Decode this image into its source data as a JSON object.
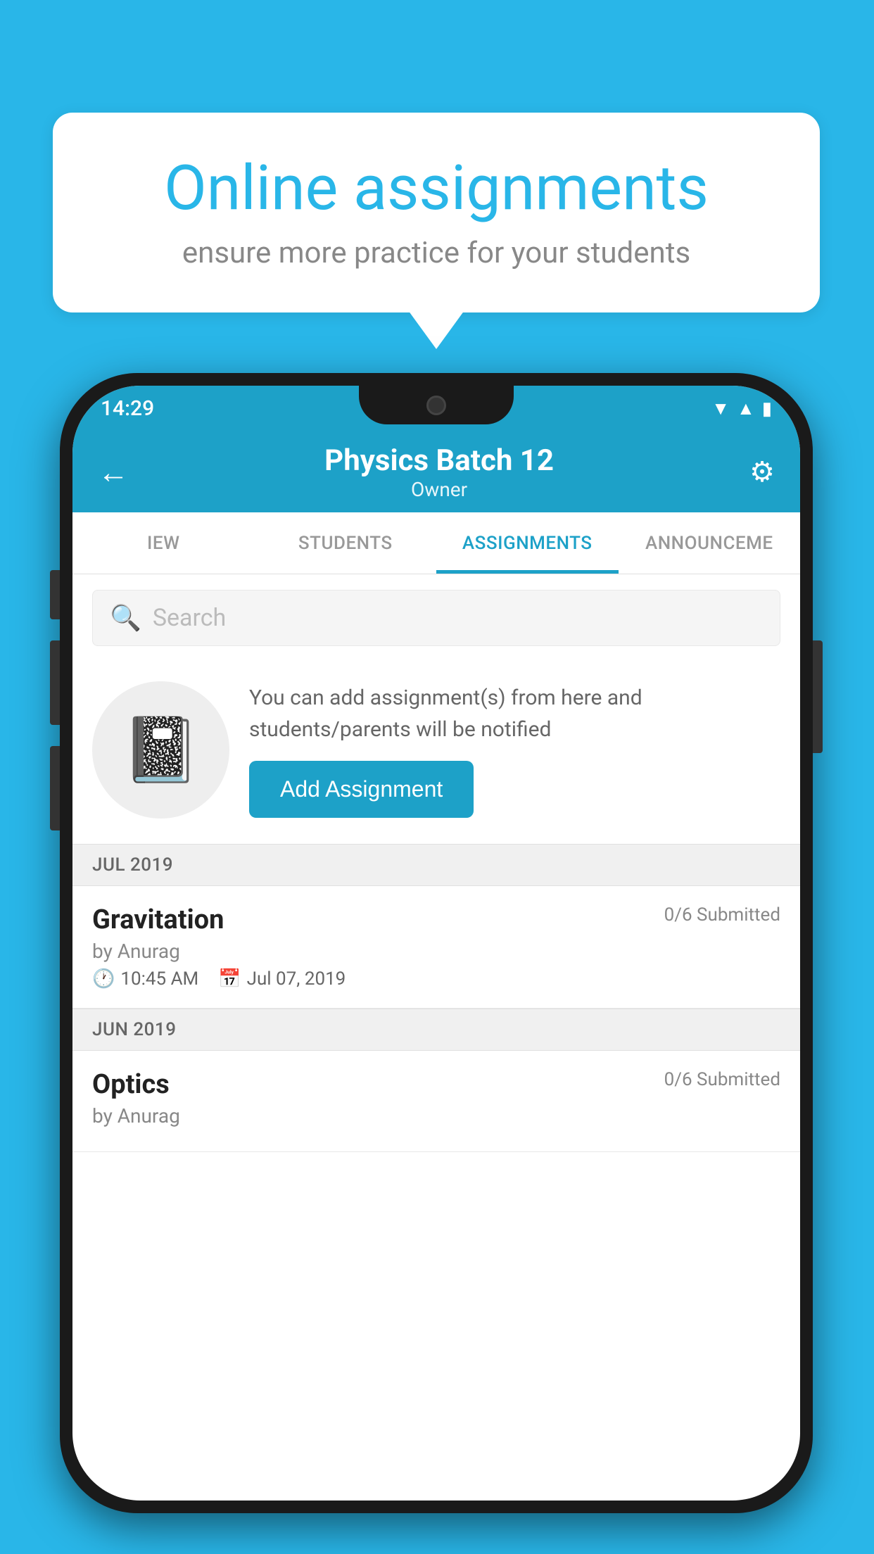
{
  "background_color": "#29b6e8",
  "speech_bubble": {
    "title": "Online assignments",
    "subtitle": "ensure more practice for your students"
  },
  "status_bar": {
    "time": "14:29",
    "wifi_icon": "▼",
    "signal_icon": "▲",
    "battery_icon": "▮"
  },
  "header": {
    "title": "Physics Batch 12",
    "subtitle": "Owner",
    "back_icon": "←",
    "settings_icon": "⚙"
  },
  "tabs": [
    {
      "label": "IEW",
      "active": false
    },
    {
      "label": "STUDENTS",
      "active": false
    },
    {
      "label": "ASSIGNMENTS",
      "active": true
    },
    {
      "label": "ANNOUNCEME",
      "active": false
    }
  ],
  "search": {
    "placeholder": "Search"
  },
  "promo": {
    "description": "You can add assignment(s) from here and students/parents will be notified",
    "button_label": "Add Assignment"
  },
  "sections": [
    {
      "month": "JUL 2019",
      "assignments": [
        {
          "title": "Gravitation",
          "submitted": "0/6 Submitted",
          "by": "by Anurag",
          "time": "10:45 AM",
          "date": "Jul 07, 2019"
        }
      ]
    },
    {
      "month": "JUN 2019",
      "assignments": [
        {
          "title": "Optics",
          "submitted": "0/6 Submitted",
          "by": "by Anurag",
          "time": "",
          "date": ""
        }
      ]
    }
  ]
}
